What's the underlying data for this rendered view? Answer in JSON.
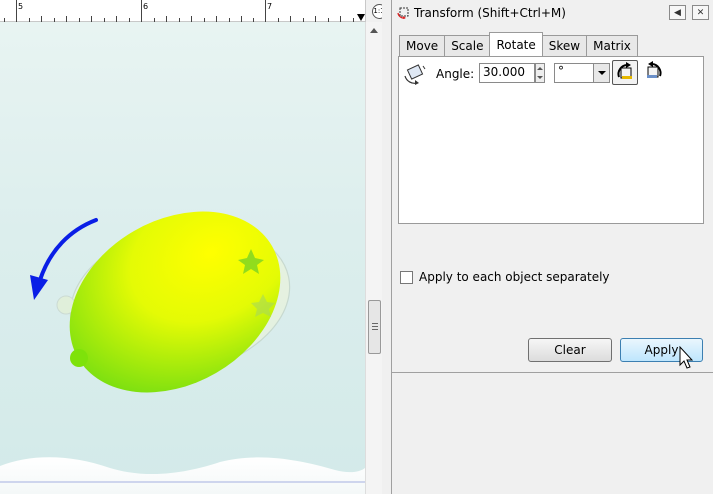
{
  "ruler": {
    "labels": [
      "5",
      "6",
      "7"
    ]
  },
  "zoom_button": {
    "label": "1:1"
  },
  "dialog": {
    "title": "Transform (Shift+Ctrl+M)",
    "tabs": [
      {
        "label": "Move",
        "active": false
      },
      {
        "label": "Scale",
        "active": false
      },
      {
        "label": "Rotate",
        "active": true
      },
      {
        "label": "Skew",
        "active": false
      },
      {
        "label": "Matrix",
        "active": false
      }
    ],
    "rotate": {
      "angle_label": "Angle:",
      "angle_value": "30.000",
      "unit_value": "°"
    },
    "apply_separately_label": "Apply to each object separately",
    "apply_separately_checked": false,
    "clear_label": "Clear",
    "apply_label": "Apply"
  },
  "icons": {
    "title": "transform-dialog-icon",
    "rotate": "rotate-tool-icon",
    "ccw": "rotate-counterclockwise-icon",
    "cw": "rotate-clockwise-icon",
    "dock": "dock-panel-icon",
    "close": "close-icon",
    "cursor": "mouse-pointer-icon"
  },
  "colors": {
    "canvas_bg": "#dceeed",
    "lemon_fill": "#e8ff00",
    "lemon_fill_dark": "#7ee20a",
    "rotation_arrow": "#0a1ee6",
    "apply_button": "#bee6fd"
  }
}
